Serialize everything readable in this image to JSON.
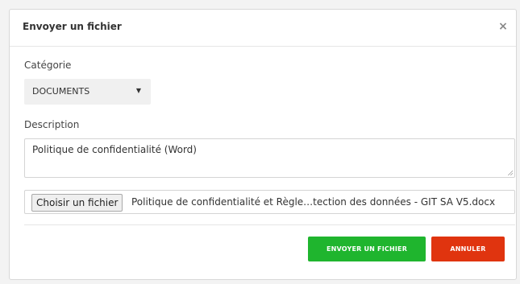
{
  "modal": {
    "title": "Envoyer un fichier",
    "close_glyph": "×"
  },
  "form": {
    "category_label": "Catégorie",
    "category_value": "DOCUMENTS",
    "category_caret": "▼",
    "description_label": "Description",
    "description_value": "Politique de confidentialité (Word)",
    "file_button_label": "Choisir un fichier",
    "file_name": "Politique de confidentialité et Règle…tection des données - GIT SA V5.docx"
  },
  "actions": {
    "send_label": "ENVOYER UN FICHIER",
    "cancel_label": "ANNULER"
  },
  "colors": {
    "send_button": "#1fb52e",
    "cancel_button": "#e0340f"
  },
  "icons": {
    "close": "close-icon",
    "dropdown": "chevron-down-icon",
    "resize": "resize-handle-icon"
  }
}
